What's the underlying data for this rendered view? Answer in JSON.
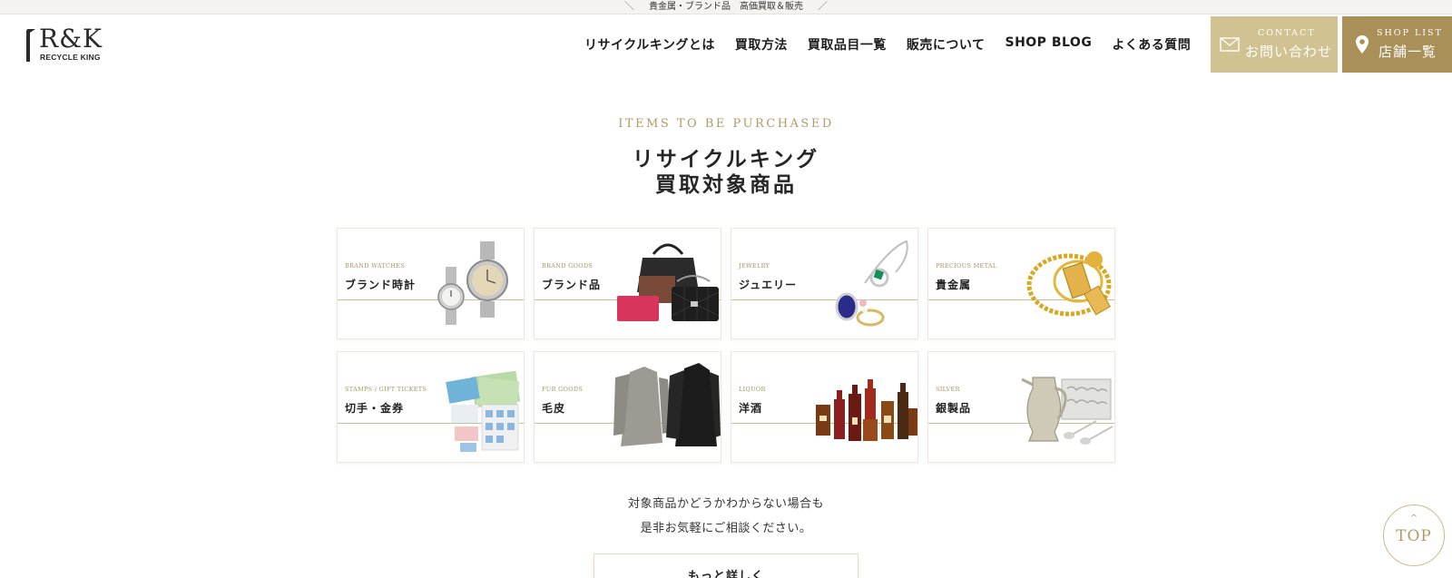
{
  "topbar": {
    "text": "貴金属・ブランド品　高価買取＆販売",
    "left_slash": "＼",
    "right_slash": "／"
  },
  "logo": {
    "main": "R&K",
    "sub": "RECYCLE KING"
  },
  "nav": {
    "items": [
      {
        "label": "リサイクルキングとは"
      },
      {
        "label": "買取方法"
      },
      {
        "label": "買取品目一覧"
      },
      {
        "label": "販売について"
      },
      {
        "label": "SHOP BLOG"
      },
      {
        "label": "よくある質問"
      }
    ]
  },
  "contact": {
    "hint": "CONTACT",
    "label": "お問い合わせ",
    "icon": "mail-icon"
  },
  "shoplist": {
    "hint": "SHOP LIST",
    "label": "店舗一覧",
    "icon": "map-pin-icon"
  },
  "section": {
    "eyebrow": "ITEMS TO BE PURCHASED",
    "title_line1": "リサイクルキング",
    "title_line2": "買取対象商品"
  },
  "categories": [
    {
      "en": "BRAND WATCHES",
      "jp": "ブランド時計",
      "icon": "watch-image"
    },
    {
      "en": "BRAND GOODS",
      "jp": "ブランド品",
      "icon": "handbag-image"
    },
    {
      "en": "JEWELRY",
      "jp": "ジュエリー",
      "icon": "ring-image"
    },
    {
      "en": "PRECIOUS METAL",
      "jp": "貴金属",
      "icon": "gold-bar-image"
    },
    {
      "en": "STAMPS / GIFT TICKETS",
      "jp": "切手・金券",
      "icon": "stamps-image"
    },
    {
      "en": "FUR GOODS",
      "jp": "毛皮",
      "icon": "fur-coat-image"
    },
    {
      "en": "LIQUOR",
      "jp": "洋酒",
      "icon": "liquor-bottles-image"
    },
    {
      "en": "SILVER",
      "jp": "銀製品",
      "icon": "silverware-image"
    }
  ],
  "note": {
    "line1": "対象商品かどうかわからない場合も",
    "line2": "是非お気軽にご相談ください。"
  },
  "more_button": {
    "label": "もっと詳しく"
  },
  "top_button": {
    "label": "TOP",
    "caret": "^"
  },
  "colors": {
    "gold": "#b09a66",
    "contact_bg": "#d1c292",
    "shop_bg": "#a89058",
    "rule": "#cbbf95"
  }
}
